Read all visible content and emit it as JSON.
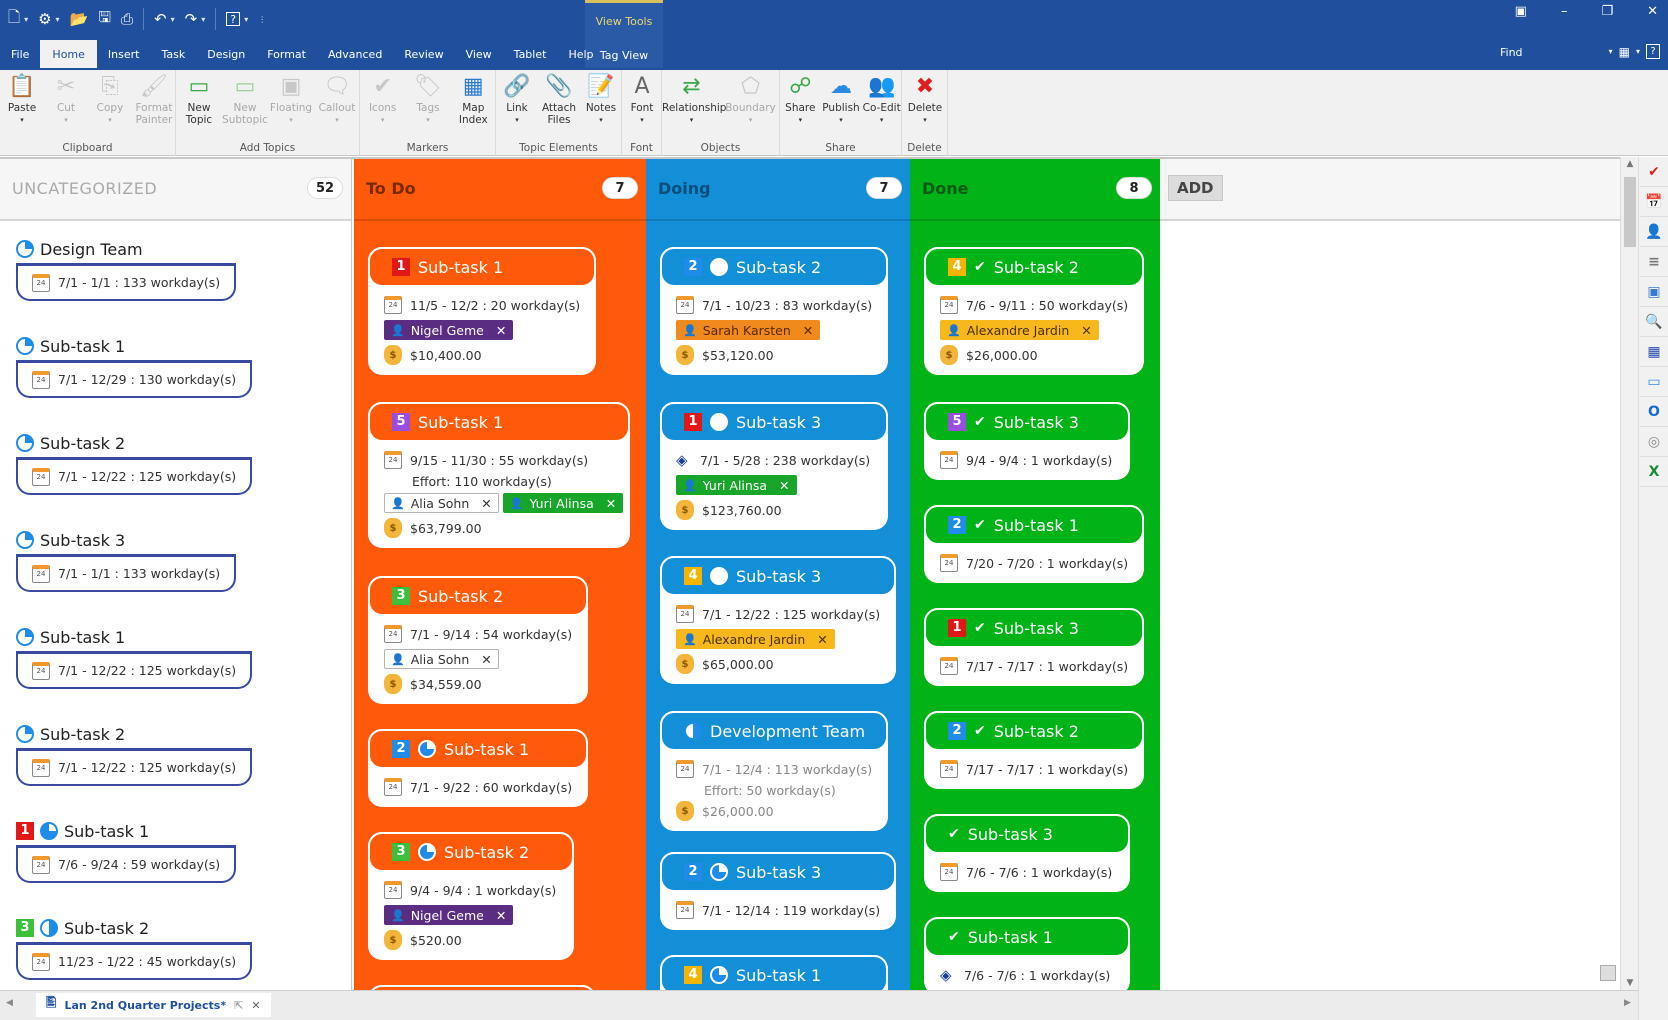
{
  "app": {
    "quick_access": [
      "new-file-icon",
      "settings-icon",
      "open-folder-icon",
      "save-icon",
      "print-icon",
      "undo-icon",
      "redo-icon",
      "help-icon"
    ],
    "context_group": "View Tools",
    "tabs": [
      "File",
      "Home",
      "Insert",
      "Task",
      "Design",
      "Format",
      "Advanced",
      "Review",
      "View",
      "Tablet",
      "Help"
    ],
    "context_tab": "Tag View",
    "active_tab": "Home",
    "find_label": "Find",
    "window_controls": [
      "ribbon-display-icon",
      "minimize-icon",
      "restore-icon",
      "close-icon"
    ]
  },
  "ribbon": {
    "groups": [
      {
        "name": "Clipboard",
        "buttons": [
          {
            "label": "Paste",
            "sub": "",
            "enabled": true
          },
          {
            "label": "Cut",
            "sub": "",
            "enabled": false
          },
          {
            "label": "Copy",
            "sub": "",
            "enabled": false
          },
          {
            "label": "Format",
            "sub": "Painter",
            "enabled": false
          }
        ]
      },
      {
        "name": "Add Topics",
        "buttons": [
          {
            "label": "New",
            "sub": "Topic",
            "enabled": true
          },
          {
            "label": "New",
            "sub": "Subtopic",
            "enabled": false
          },
          {
            "label": "Floating",
            "sub": "",
            "enabled": false
          },
          {
            "label": "Callout",
            "sub": "",
            "enabled": false
          }
        ]
      },
      {
        "name": "Markers",
        "buttons": [
          {
            "label": "Icons",
            "sub": "",
            "enabled": false
          },
          {
            "label": "Tags",
            "sub": "",
            "enabled": false
          },
          {
            "label": "Map",
            "sub": "Index",
            "enabled": true
          }
        ]
      },
      {
        "name": "Topic Elements",
        "buttons": [
          {
            "label": "Link",
            "sub": "",
            "enabled": true
          },
          {
            "label": "Attach",
            "sub": "Files",
            "enabled": true
          },
          {
            "label": "Notes",
            "sub": "",
            "enabled": true
          }
        ]
      },
      {
        "name": "Font",
        "buttons": [
          {
            "label": "Font",
            "sub": "",
            "enabled": true
          }
        ]
      },
      {
        "name": "Objects",
        "buttons": [
          {
            "label": "Relationship",
            "sub": "",
            "enabled": true
          },
          {
            "label": "Boundary",
            "sub": "",
            "enabled": false
          }
        ]
      },
      {
        "name": "Share",
        "buttons": [
          {
            "label": "Share",
            "sub": "",
            "enabled": true
          },
          {
            "label": "Publish",
            "sub": "",
            "enabled": true
          },
          {
            "label": "Co-Edit",
            "sub": "",
            "enabled": true
          }
        ]
      },
      {
        "name": "Delete",
        "buttons": [
          {
            "label": "Delete",
            "sub": "",
            "enabled": true
          }
        ]
      }
    ]
  },
  "board": {
    "add_label": "ADD",
    "columns": [
      {
        "title": "UNCATEGORIZED",
        "count": "52"
      },
      {
        "title": "To Do",
        "count": "7"
      },
      {
        "title": "Doing",
        "count": "7"
      },
      {
        "title": "Done",
        "count": "8"
      }
    ],
    "uncategorized": [
      {
        "title": "Design Team",
        "dates": "7/1 - 1/1 : 133 workday(s)",
        "priority": "",
        "progress": "quarter"
      },
      {
        "title": "Sub-task 1",
        "dates": "7/1 - 12/29 : 130 workday(s)",
        "priority": "",
        "progress": "quarter"
      },
      {
        "title": "Sub-task 2",
        "dates": "7/1 - 12/22 : 125 workday(s)",
        "priority": "",
        "progress": "quarter"
      },
      {
        "title": "Sub-task 3",
        "dates": "7/1 - 1/1 : 133 workday(s)",
        "priority": "",
        "progress": "quarter"
      },
      {
        "title": "Sub-task 1",
        "dates": "7/1 - 12/22 : 125 workday(s)",
        "priority": "",
        "progress": "quarter"
      },
      {
        "title": "Sub-task 2",
        "dates": "7/1 - 12/22 : 125 workday(s)",
        "priority": "",
        "progress": "quarter"
      },
      {
        "title": "Sub-task 1",
        "dates": "7/6 - 9/24 : 59 workday(s)",
        "priority": "1",
        "progress": "three-quarter"
      },
      {
        "title": "Sub-task 2",
        "dates": "11/23 - 1/22 : 45 workday(s)",
        "priority": "3",
        "progress": "half"
      }
    ],
    "todo": [
      {
        "title": "Sub-task 1",
        "priority": "1",
        "progress": "",
        "dates": "11/5 - 12/2 : 20 workday(s)",
        "effort": "",
        "resources": [
          {
            "name": "Nigel Geme",
            "style": "purple"
          }
        ],
        "cost": "$10,400.00"
      },
      {
        "title": "Sub-task 1",
        "priority": "5",
        "progress": "",
        "dates": "9/15 - 11/30 : 55 workday(s)",
        "effort": "Effort: 110 workday(s)",
        "resources": [
          {
            "name": "Alia Sohn",
            "style": "white"
          },
          {
            "name": "Yuri Alinsa",
            "style": "green"
          }
        ],
        "cost": "$63,799.00"
      },
      {
        "title": "Sub-task 2",
        "priority": "3",
        "progress": "",
        "dates": "7/1 - 9/14 : 54 workday(s)",
        "effort": "",
        "resources": [
          {
            "name": "Alia Sohn",
            "style": "white"
          }
        ],
        "cost": "$34,559.00"
      },
      {
        "title": "Sub-task 1",
        "priority": "2",
        "progress": "three-quarter",
        "dates": "7/1 - 9/22 : 60 workday(s)",
        "effort": "",
        "resources": [],
        "cost": ""
      },
      {
        "title": "Sub-task 2",
        "priority": "3",
        "progress": "three-quarter",
        "dates": "9/4 - 9/4 : 1 workday(s)",
        "effort": "",
        "resources": [
          {
            "name": "Nigel Geme",
            "style": "purple"
          }
        ],
        "cost": "$520.00"
      }
    ],
    "doing": [
      {
        "title": "Sub-task 2",
        "priority": "2",
        "progress": "none",
        "dates": "7/1 - 10/23 : 83 workday(s)",
        "milestone": false,
        "effort": "",
        "resources": [
          {
            "name": "Sarah Karsten",
            "style": "orange"
          }
        ],
        "cost": "$53,120.00"
      },
      {
        "title": "Sub-task 3",
        "priority": "1",
        "progress": "none",
        "dates": "7/1 - 5/28 : 238 workday(s)",
        "milestone": true,
        "effort": "",
        "resources": [
          {
            "name": "Yuri Alinsa",
            "style": "green"
          }
        ],
        "cost": "$123,760.00"
      },
      {
        "title": "Sub-task 3",
        "priority": "4",
        "progress": "none",
        "dates": "7/1 - 12/22 : 125 workday(s)",
        "milestone": false,
        "effort": "",
        "resources": [
          {
            "name": "Alexandre Jardin",
            "style": "yellow"
          }
        ],
        "cost": "$65,000.00"
      },
      {
        "title": "Development Team",
        "priority": "",
        "progress": "half",
        "dates": "7/1 - 12/4 : 113 workday(s)",
        "milestone": false,
        "effort": "Effort: 50 workday(s)",
        "resources": [],
        "cost": "$26,000.00"
      },
      {
        "title": "Sub-task 3",
        "priority": "2",
        "progress": "three-quarter",
        "dates": "7/1 - 12/14 : 119 workday(s)",
        "milestone": false,
        "effort": "",
        "resources": [],
        "cost": ""
      },
      {
        "title": "Sub-task 1",
        "priority": "4",
        "progress": "three-quarter",
        "dates": "",
        "milestone": false,
        "effort": "",
        "resources": [],
        "cost": ""
      }
    ],
    "done": [
      {
        "title": "Sub-task 2",
        "priority": "4",
        "dates": "7/6 - 9/11 : 50 workday(s)",
        "milestone": false,
        "resources": [
          {
            "name": "Alexandre Jardin",
            "style": "yellow"
          }
        ],
        "cost": "$26,000.00"
      },
      {
        "title": "Sub-task 3",
        "priority": "5",
        "dates": "9/4 - 9/4 : 1 workday(s)",
        "milestone": false,
        "resources": [],
        "cost": ""
      },
      {
        "title": "Sub-task 1",
        "priority": "2",
        "dates": "7/20 - 7/20 : 1 workday(s)",
        "milestone": false,
        "resources": [],
        "cost": ""
      },
      {
        "title": "Sub-task 3",
        "priority": "1",
        "dates": "7/17 - 7/17 : 1 workday(s)",
        "milestone": false,
        "resources": [],
        "cost": ""
      },
      {
        "title": "Sub-task 2",
        "priority": "2",
        "dates": "7/17 - 7/17 : 1 workday(s)",
        "milestone": false,
        "resources": [],
        "cost": ""
      },
      {
        "title": "Sub-task 3",
        "priority": "",
        "dates": "7/6 - 7/6 : 1 workday(s)",
        "milestone": false,
        "resources": [],
        "cost": ""
      },
      {
        "title": "Sub-task 1",
        "priority": "",
        "dates": "7/6 - 7/6 : 1 workday(s)",
        "milestone": true,
        "resources": [],
        "cost": ""
      }
    ]
  },
  "colors": {
    "priority": {
      "1": "#e01818",
      "2": "#1e8ce8",
      "3": "#3cc03c",
      "4": "#f4b400",
      "5": "#9b4de0"
    },
    "tag_styles": {
      "purple": {
        "bg": "#5a2d82",
        "fg": "#ffffff",
        "border": "#5a2d82"
      },
      "white": {
        "bg": "#ffffff",
        "fg": "#333333",
        "border": "#b5b5b5"
      },
      "green": {
        "bg": "#17a52a",
        "fg": "#ffffff",
        "border": "#17a52a"
      },
      "orange": {
        "bg": "#f08a1c",
        "fg": "#5a2a00",
        "border": "#f08a1c"
      },
      "yellow": {
        "bg": "#f7b81c",
        "fg": "#4a3000",
        "border": "#f7b81c"
      }
    }
  },
  "status": {
    "document_tab": "Lan 2nd Quarter Projects*"
  },
  "side_panel": [
    "task-info-icon",
    "calendar-icon",
    "resource-icon",
    "outline-icon",
    "theme-icon",
    "search-icon",
    "layout-icon",
    "slideshow-icon",
    "outlook-icon",
    "globe-icon",
    "excel-icon"
  ]
}
